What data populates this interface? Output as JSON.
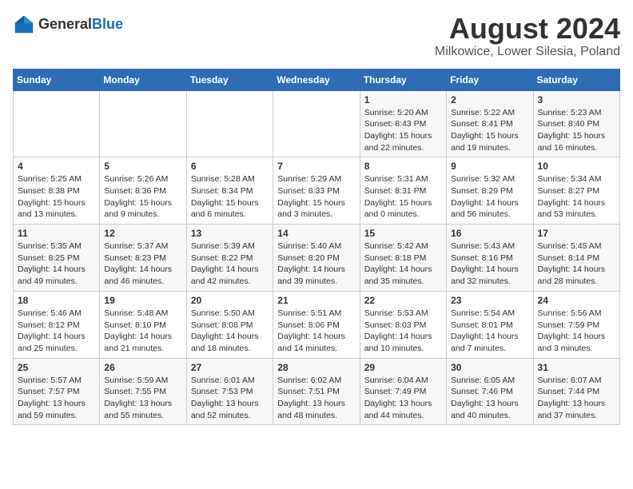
{
  "logo": {
    "text_general": "General",
    "text_blue": "Blue"
  },
  "title": {
    "month_year": "August 2024",
    "location": "Milkowice, Lower Silesia, Poland"
  },
  "days_of_week": [
    "Sunday",
    "Monday",
    "Tuesday",
    "Wednesday",
    "Thursday",
    "Friday",
    "Saturday"
  ],
  "weeks": [
    [
      {
        "day": "",
        "info": ""
      },
      {
        "day": "",
        "info": ""
      },
      {
        "day": "",
        "info": ""
      },
      {
        "day": "",
        "info": ""
      },
      {
        "day": "1",
        "info": "Sunrise: 5:20 AM\nSunset: 8:43 PM\nDaylight: 15 hours and 22 minutes."
      },
      {
        "day": "2",
        "info": "Sunrise: 5:22 AM\nSunset: 8:41 PM\nDaylight: 15 hours and 19 minutes."
      },
      {
        "day": "3",
        "info": "Sunrise: 5:23 AM\nSunset: 8:40 PM\nDaylight: 15 hours and 16 minutes."
      }
    ],
    [
      {
        "day": "4",
        "info": "Sunrise: 5:25 AM\nSunset: 8:38 PM\nDaylight: 15 hours and 13 minutes."
      },
      {
        "day": "5",
        "info": "Sunrise: 5:26 AM\nSunset: 8:36 PM\nDaylight: 15 hours and 9 minutes."
      },
      {
        "day": "6",
        "info": "Sunrise: 5:28 AM\nSunset: 8:34 PM\nDaylight: 15 hours and 6 minutes."
      },
      {
        "day": "7",
        "info": "Sunrise: 5:29 AM\nSunset: 8:33 PM\nDaylight: 15 hours and 3 minutes."
      },
      {
        "day": "8",
        "info": "Sunrise: 5:31 AM\nSunset: 8:31 PM\nDaylight: 15 hours and 0 minutes."
      },
      {
        "day": "9",
        "info": "Sunrise: 5:32 AM\nSunset: 8:29 PM\nDaylight: 14 hours and 56 minutes."
      },
      {
        "day": "10",
        "info": "Sunrise: 5:34 AM\nSunset: 8:27 PM\nDaylight: 14 hours and 53 minutes."
      }
    ],
    [
      {
        "day": "11",
        "info": "Sunrise: 5:35 AM\nSunset: 8:25 PM\nDaylight: 14 hours and 49 minutes."
      },
      {
        "day": "12",
        "info": "Sunrise: 5:37 AM\nSunset: 8:23 PM\nDaylight: 14 hours and 46 minutes."
      },
      {
        "day": "13",
        "info": "Sunrise: 5:39 AM\nSunset: 8:22 PM\nDaylight: 14 hours and 42 minutes."
      },
      {
        "day": "14",
        "info": "Sunrise: 5:40 AM\nSunset: 8:20 PM\nDaylight: 14 hours and 39 minutes."
      },
      {
        "day": "15",
        "info": "Sunrise: 5:42 AM\nSunset: 8:18 PM\nDaylight: 14 hours and 35 minutes."
      },
      {
        "day": "16",
        "info": "Sunrise: 5:43 AM\nSunset: 8:16 PM\nDaylight: 14 hours and 32 minutes."
      },
      {
        "day": "17",
        "info": "Sunrise: 5:45 AM\nSunset: 8:14 PM\nDaylight: 14 hours and 28 minutes."
      }
    ],
    [
      {
        "day": "18",
        "info": "Sunrise: 5:46 AM\nSunset: 8:12 PM\nDaylight: 14 hours and 25 minutes."
      },
      {
        "day": "19",
        "info": "Sunrise: 5:48 AM\nSunset: 8:10 PM\nDaylight: 14 hours and 21 minutes."
      },
      {
        "day": "20",
        "info": "Sunrise: 5:50 AM\nSunset: 8:08 PM\nDaylight: 14 hours and 18 minutes."
      },
      {
        "day": "21",
        "info": "Sunrise: 5:51 AM\nSunset: 8:06 PM\nDaylight: 14 hours and 14 minutes."
      },
      {
        "day": "22",
        "info": "Sunrise: 5:53 AM\nSunset: 8:03 PM\nDaylight: 14 hours and 10 minutes."
      },
      {
        "day": "23",
        "info": "Sunrise: 5:54 AM\nSunset: 8:01 PM\nDaylight: 14 hours and 7 minutes."
      },
      {
        "day": "24",
        "info": "Sunrise: 5:56 AM\nSunset: 7:59 PM\nDaylight: 14 hours and 3 minutes."
      }
    ],
    [
      {
        "day": "25",
        "info": "Sunrise: 5:57 AM\nSunset: 7:57 PM\nDaylight: 13 hours and 59 minutes."
      },
      {
        "day": "26",
        "info": "Sunrise: 5:59 AM\nSunset: 7:55 PM\nDaylight: 13 hours and 55 minutes."
      },
      {
        "day": "27",
        "info": "Sunrise: 6:01 AM\nSunset: 7:53 PM\nDaylight: 13 hours and 52 minutes."
      },
      {
        "day": "28",
        "info": "Sunrise: 6:02 AM\nSunset: 7:51 PM\nDaylight: 13 hours and 48 minutes."
      },
      {
        "day": "29",
        "info": "Sunrise: 6:04 AM\nSunset: 7:49 PM\nDaylight: 13 hours and 44 minutes."
      },
      {
        "day": "30",
        "info": "Sunrise: 6:05 AM\nSunset: 7:46 PM\nDaylight: 13 hours and 40 minutes."
      },
      {
        "day": "31",
        "info": "Sunrise: 6:07 AM\nSunset: 7:44 PM\nDaylight: 13 hours and 37 minutes."
      }
    ]
  ]
}
